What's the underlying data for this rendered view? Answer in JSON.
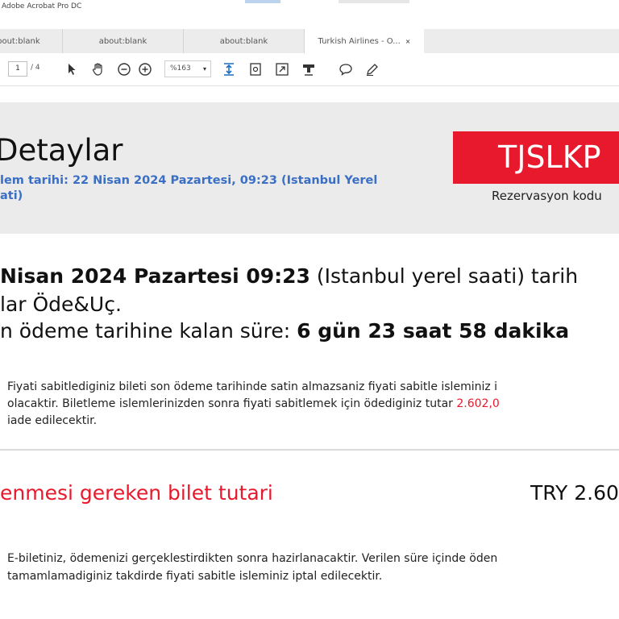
{
  "window": {
    "app_title": "Adobe Acrobat Pro DC"
  },
  "tabs": [
    {
      "label": "about:blank"
    },
    {
      "label": "about:blank"
    },
    {
      "label": "about:blank"
    },
    {
      "label": "Turkish Airlines - O...",
      "close": "×"
    }
  ],
  "toolbar": {
    "page_current": "1",
    "page_total": "/ 4",
    "zoom": "%163",
    "zoom_arrow": "▾",
    "icons": [
      "select-arrow-icon",
      "hand-icon",
      "zoom-out-icon",
      "zoom-in-icon",
      "fit-page-icon",
      "page-view-icon",
      "fullscreen-icon",
      "stamp-icon",
      "comment-icon",
      "pen-icon"
    ]
  },
  "document": {
    "title": "Detaylar",
    "transaction_date": "lem tarihi: 22 Nisan 2024 Pazartesi, 09:23 (Istanbul Yerel\nati)",
    "pnr_code": "TJSLKP",
    "pnr_label": "Rezervasyon kodu",
    "line1_bold": "Nisan 2024 Pazartesi 09:23",
    "line1_rest": " (Istanbul yerel saati) tarih",
    "line2": "lar Öde&Uç.",
    "line3_prefix": "n ödeme tarihine kalan süre: ",
    "line3_bold": "6 gün 23 saat 58 dakika",
    "note1_part1": "Fiyati sabitlediginiz bileti son ödeme tarihinde satin almazsaniz fiyati sabitle isleminiz i",
    "note1_part2": "olacaktir. Biletleme islemlerinizden sonra fiyati sabitlemek için ödediginiz tutar ",
    "note1_amount": "2.602,0",
    "note1_part3": "iade edilecektir.",
    "pay_label": "enmesi gereken bilet tutari",
    "pay_amount": "TRY 2.60",
    "note2_line1": "E-biletiniz, ödemenizi gerçeklestirdikten sonra hazirlanacaktir. Verilen süre içinde öden",
    "note2_line2": "tamamlamadiginiz takdirde fiyati sabitle isleminiz iptal edilecektir."
  },
  "colors": {
    "brand_red": "#e8192c",
    "link_blue": "#3a6fc4",
    "panel_gray": "#ebebeb"
  }
}
